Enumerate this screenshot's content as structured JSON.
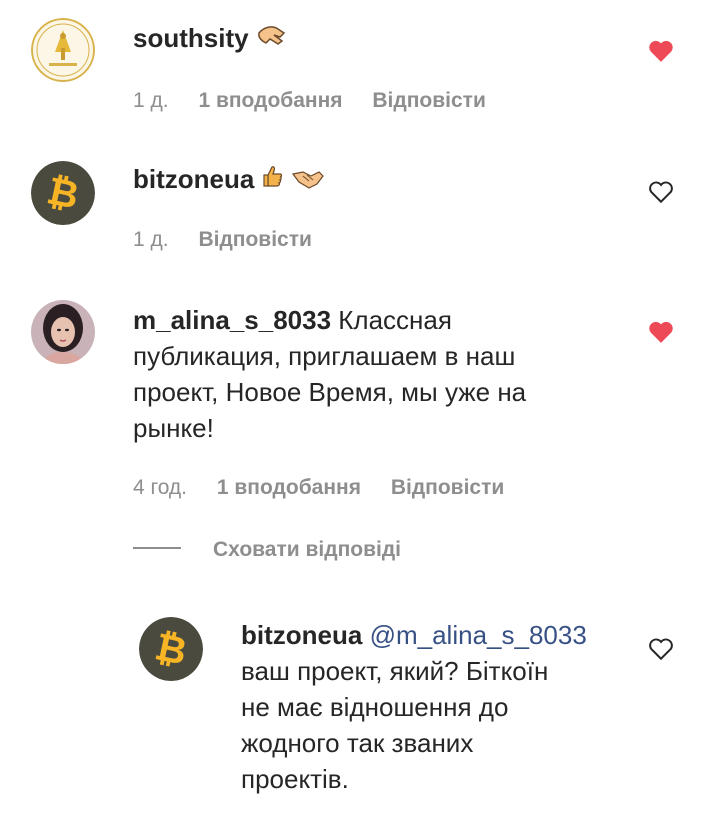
{
  "comments": [
    {
      "username": "southsity",
      "text": "",
      "time": "1 д.",
      "likes": "1 вподобання",
      "reply": "Відповісти",
      "liked": true,
      "avatar": "golden-logo"
    },
    {
      "username": "bitzoneua",
      "text": "",
      "time": "1 д.",
      "reply": "Відповісти",
      "liked": false,
      "avatar": "bitcoin-logo"
    },
    {
      "username": "m_alina_s_8033",
      "text_line1": "Классная",
      "text_line2": "публикация, приглашаем в наш",
      "text_line3": "проект, Новое Время, мы уже на",
      "text_line4": "рынке!",
      "time": "4 год.",
      "likes": "1 вподобання",
      "reply": "Відповісти",
      "liked": true,
      "avatar": "user-photo"
    }
  ],
  "hide_replies": "Сховати відповіді",
  "reply_comment": {
    "username": "bitzoneua",
    "mention": "@m_alina_s_8033",
    "text_line1": "ваш проект, який? Біткоїн",
    "text_line2": "не має відношення до",
    "text_line3": "жодного так званих",
    "text_line4": "проектів.",
    "liked": false,
    "avatar": "bitcoin-logo"
  },
  "colors": {
    "heart_liked": "#ed4956",
    "meta_gray": "#8e8e8e",
    "mention_blue": "#385185",
    "bitcoin_orange": "#f7b526",
    "bitcoin_bg": "#4a4a3e"
  }
}
